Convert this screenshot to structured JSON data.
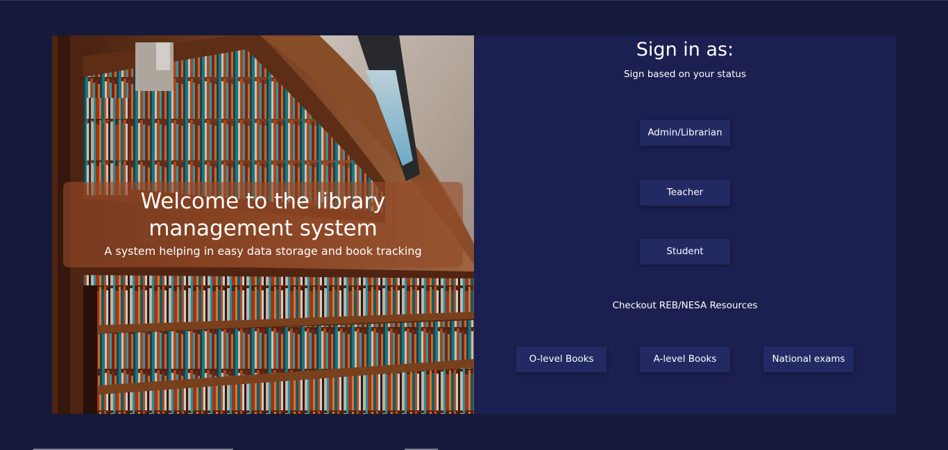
{
  "hero": {
    "title": "Welcome to the library management system",
    "subtitle": "A system helping in easy data storage and book tracking",
    "image_name": "library-bookshelves-image"
  },
  "signin": {
    "title": "Sign in as:",
    "subtitle": "Sign based on your status",
    "roles": [
      "Admin/Librarian",
      "Teacher",
      "Student"
    ]
  },
  "resources": {
    "label": "Checkout REB/NESA Resources",
    "buttons": [
      "O-level Books",
      "A-level Books",
      "National exams"
    ]
  },
  "colors": {
    "page_background": "#161a3a",
    "card_background": "#1c2050",
    "button_background": "#232a63",
    "text": "#ffffff"
  }
}
